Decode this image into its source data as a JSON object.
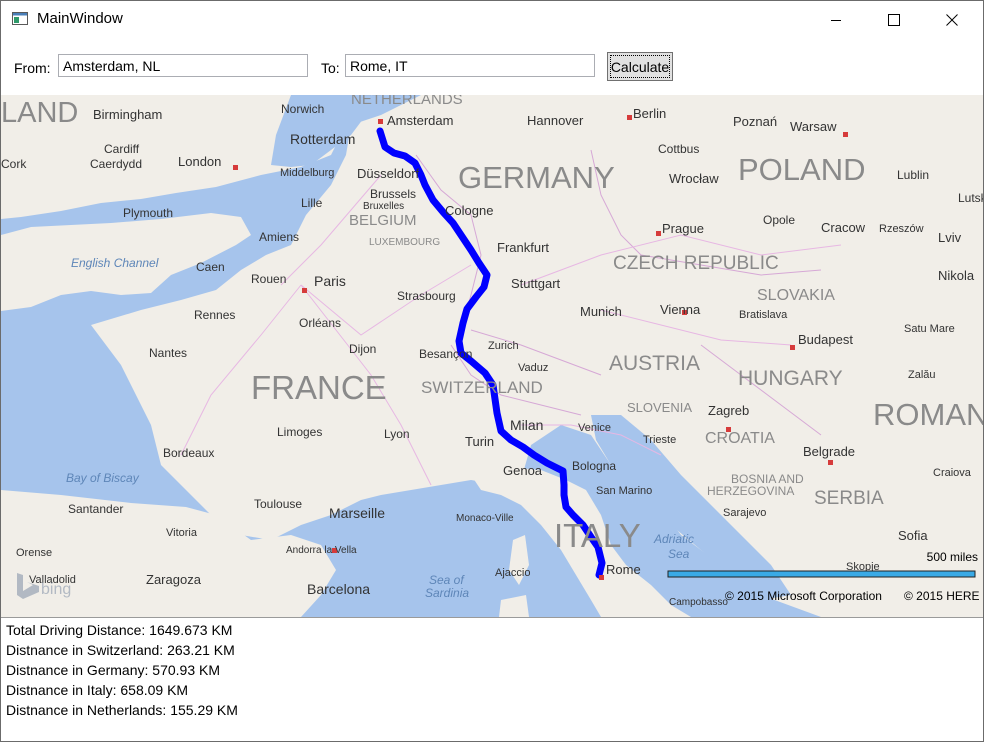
{
  "window": {
    "title": "MainWindow"
  },
  "form": {
    "from_label": "From:",
    "from_value": "Amsterdam, NL",
    "to_label": "To:",
    "to_value": "Rome, IT",
    "calculate_label": "Calculate"
  },
  "map": {
    "countries": [
      "LAND",
      "NETHERLANDS",
      "GERMANY",
      "POLAND",
      "BELGIUM",
      "LUXEMBOURG",
      "CZECH REPUBLIC",
      "SLOVAKIA",
      "FRANCE",
      "AUSTRIA",
      "HUNGARY",
      "SWITZERLAND",
      "SLOVENIA",
      "CROATIA",
      "ROMAN",
      "BOSNIA AND",
      "HERZEGOVINA",
      "SERBIA",
      "ITALY"
    ],
    "cities": [
      "Birmingham",
      "Norwich",
      "Rotterdam",
      "Amsterdam",
      "Hannover",
      "Berlin",
      "Poznań",
      "Warsaw",
      "Cardiff",
      "Caerdydd",
      "London",
      "Cork",
      "Middelburg",
      "Düsseldorf",
      "Cottbus",
      "Wrocław",
      "Lublin",
      "Brussels",
      "Bruxelles",
      "Lille",
      "Cologne",
      "Plymouth",
      "Prague",
      "Opole",
      "Cracow",
      "Rzeszów",
      "Lutsk",
      "Amiens",
      "Frankfurt",
      "Lviv",
      "Caen",
      "Rouen",
      "Paris",
      "Stuttgart",
      "Nikola",
      "Strasbourg",
      "Rennes",
      "Munich",
      "Vienna",
      "Bratislava",
      "Orléans",
      "Satu Mare",
      "Zurich",
      "Vaduz",
      "Nantes",
      "Dijon",
      "Besançon",
      "Budapest",
      "Zalău",
      "Limoges",
      "Lyon",
      "Milan",
      "Venice",
      "Trieste",
      "Zagreb",
      "Turin",
      "Bordeaux",
      "Genoa",
      "Bologna",
      "Belgrade",
      "Craiova",
      "San Marino",
      "Santander",
      "Toulouse",
      "Marseille",
      "Monaco-Ville",
      "Vitoria",
      "Sarajevo",
      "Sofia",
      "Orense",
      "Andorra la Vella",
      "Skopje",
      "Valladolid",
      "Zaragoza",
      "Ajaccio",
      "Rome",
      "Barcelona",
      "Campobasso"
    ],
    "seas": [
      "English Channel",
      "Bay of Biscay",
      "Adriatic",
      "Sea",
      "Sea of",
      "Sardinia"
    ],
    "scale_label": "500 miles",
    "copyright_ms": "© 2015 Microsoft Corporation",
    "copyright_here": "© 2015 HERE",
    "bing_logo": "bing",
    "route_color": "#0000ff",
    "water_color": "#a6c4ec",
    "land_color": "#f1eee8"
  },
  "results": {
    "total": "Total Driving Distance: 1649.673 KM",
    "switzerland": "Distnance in Switzerland: 263.21 KM",
    "germany": "Distnance in Germany: 570.93 KM",
    "italy": "Distnance in Italy: 658.09 KM",
    "netherlands": "Distnance in Netherlands: 155.29 KM"
  }
}
